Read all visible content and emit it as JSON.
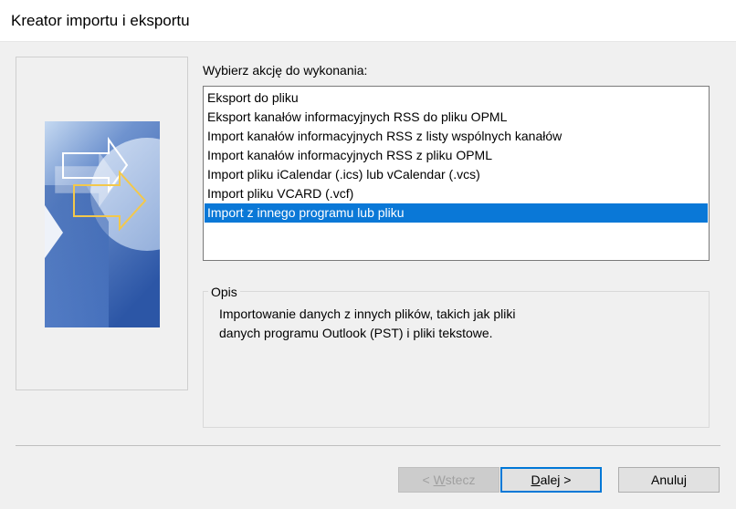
{
  "window": {
    "title": "Kreator importu i eksportu"
  },
  "action_label": "Wybierz akcję do wykonania:",
  "actions": [
    "Eksport do pliku",
    "Eksport kanałów informacyjnych RSS do pliku OPML",
    "Import kanałów informacyjnych RSS z listy wspólnych kanałów",
    "Import kanałów informacyjnych RSS z pliku OPML",
    "Import pliku iCalendar (.ics) lub vCalendar (.vcs)",
    "Import pliku VCARD (.vcf)",
    "Import z innego programu lub pliku"
  ],
  "selected_action_index": 6,
  "description": {
    "legend": "Opis",
    "line1": "Importowanie danych z innych plików, takich jak pliki",
    "line2": "danych programu Outlook (PST) i pliki tekstowe."
  },
  "buttons": {
    "back_prefix": "< ",
    "back_access": "W",
    "back_rest": "stecz",
    "next_access": "D",
    "next_rest": "alej >",
    "cancel": "Anuluj"
  },
  "colors": {
    "selection": "#0a78d7",
    "default_button_border": "#0078d7"
  }
}
